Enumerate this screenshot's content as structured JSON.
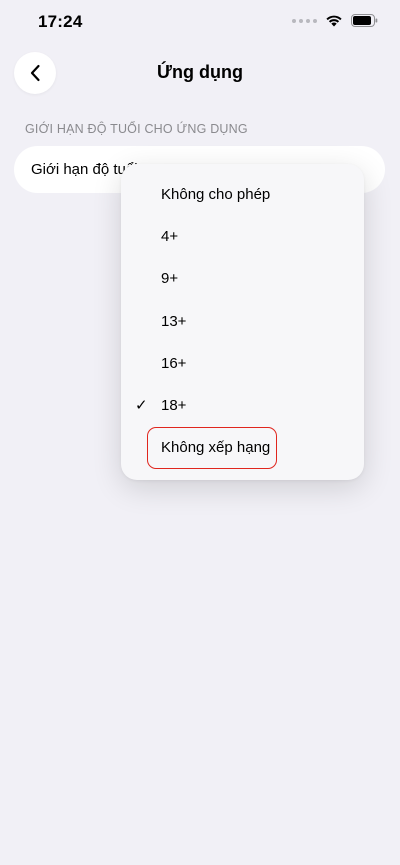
{
  "status_bar": {
    "time": "17:24"
  },
  "header": {
    "title": "Ứng dụng"
  },
  "section": {
    "header": "GIỚI HẠN ĐỘ TUỔI CHO ỨNG DỤNG",
    "row_label": "Giới hạn độ tuổi"
  },
  "menu": {
    "items": [
      {
        "label": "Không cho phép",
        "checked": false
      },
      {
        "label": "4+",
        "checked": false
      },
      {
        "label": "9+",
        "checked": false
      },
      {
        "label": "13+",
        "checked": false
      },
      {
        "label": "16+",
        "checked": false
      },
      {
        "label": "18+",
        "checked": true
      },
      {
        "label": "Không xếp hạng",
        "checked": false
      }
    ],
    "check_mark": "✓"
  },
  "colors": {
    "background": "#F1F0F6",
    "highlight": "#E0261E"
  }
}
